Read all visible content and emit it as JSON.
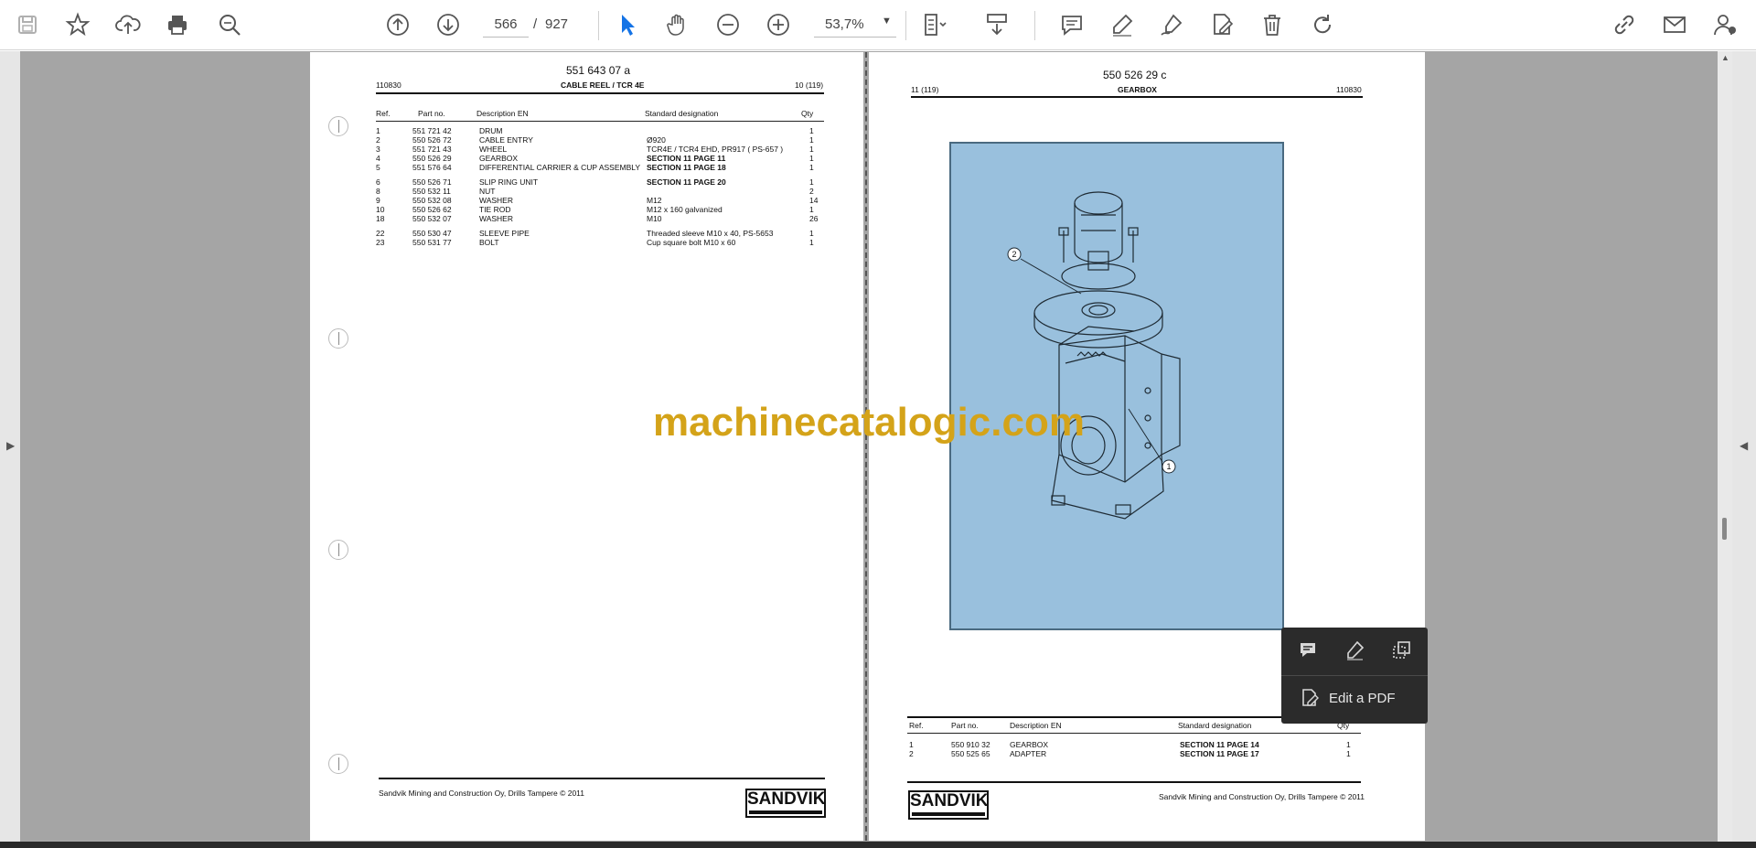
{
  "toolbar": {
    "icons": [
      "save-icon",
      "bookmark-star-icon",
      "upload-cloud-icon",
      "print-icon",
      "zoom-search-icon",
      "page-up-icon",
      "page-down-icon",
      "select-cursor-icon",
      "hand-tool-icon",
      "zoom-out-icon",
      "zoom-in-icon",
      "fit-page-icon",
      "scroll-mode-icon",
      "comment-icon",
      "highlight-icon",
      "sign-icon",
      "edit-pdf-icon",
      "delete-icon",
      "rotate-icon",
      "share-link-icon",
      "email-icon",
      "account-icon"
    ],
    "current_page": "566",
    "page_separator": "/",
    "total_pages": "927",
    "zoom": "53,7%"
  },
  "watermark": "machinecatalogic.com",
  "left_page": {
    "doc_number": "551 643 07 a",
    "date_code": "110830",
    "title": "CABLE REEL / TCR 4E",
    "page_ref": "10 (119)",
    "headers": {
      "ref": "Ref.",
      "part_no": "Part no.",
      "description": "Description EN",
      "standard": "Standard designation",
      "qty": "Qty"
    },
    "rows": [
      {
        "ref": "1",
        "part_no": "551 721 42",
        "description": "DRUM",
        "standard": "",
        "qty": "1"
      },
      {
        "ref": "2",
        "part_no": "550 526 72",
        "description": "CABLE ENTRY",
        "standard": "Ø920",
        "qty": "1"
      },
      {
        "ref": "3",
        "part_no": "551 721 43",
        "description": "WHEEL",
        "standard": "TCR4E / TCR4 EHD, PR917 ( PS-657 )",
        "qty": "1"
      },
      {
        "ref": "4",
        "part_no": "550 526 29",
        "description": "GEARBOX",
        "standard": "SECTION 11 PAGE 11",
        "qty": "1"
      },
      {
        "ref": "5",
        "part_no": "551 576 64",
        "description": "DIFFERENTIAL CARRIER & CUP ASSEMBLY",
        "standard": "SECTION 11 PAGE 18",
        "qty": "1"
      },
      {
        "ref": "6",
        "part_no": "550 526 71",
        "description": "SLIP RING UNIT",
        "standard": "SECTION 11 PAGE 20",
        "qty": "1"
      },
      {
        "ref": "8",
        "part_no": "550 532 11",
        "description": "NUT",
        "standard": "",
        "qty": "2"
      },
      {
        "ref": "9",
        "part_no": "550 532 08",
        "description": "WASHER",
        "standard": "M12",
        "qty": "14"
      },
      {
        "ref": "10",
        "part_no": "550 526 62",
        "description": "TIE ROD",
        "standard": "M12 x 160 galvanized",
        "qty": "1"
      },
      {
        "ref": "18",
        "part_no": "550 532 07",
        "description": "WASHER",
        "standard": "M10",
        "qty": "26"
      },
      {
        "ref": "22",
        "part_no": "550 530 47",
        "description": "SLEEVE PIPE",
        "standard": "Threaded sleeve M10 x 40, PS-5653",
        "qty": "1"
      },
      {
        "ref": "23",
        "part_no": "550 531 77",
        "description": "BOLT",
        "standard": "Cup square bolt M10 x 60",
        "qty": "1"
      }
    ],
    "footer": "Sandvik Mining and Construction Oy, Drills Tampere © 2011",
    "logo": "SANDVIK"
  },
  "right_page": {
    "doc_number": "550 526 29 c",
    "page_ref": "11 (119)",
    "title": "GEARBOX",
    "date_code": "110830",
    "callouts": [
      "2",
      "1"
    ],
    "headers": {
      "ref": "Ref.",
      "part_no": "Part no.",
      "description": "Description EN",
      "standard": "Standard designation",
      "qty": "Qty"
    },
    "rows": [
      {
        "ref": "1",
        "part_no": "550 910 32",
        "description": "GEARBOX",
        "standard": "SECTION 11 PAGE 14",
        "qty": "1"
      },
      {
        "ref": "2",
        "part_no": "550 525 65",
        "description": "ADAPTER",
        "standard": "SECTION 11 PAGE 17",
        "qty": "1"
      }
    ],
    "footer": "Sandvik Mining and Construction Oy, Drills Tampere © 2011",
    "logo": "SANDVIK"
  },
  "popup": {
    "icons": [
      "comment-icon",
      "highlight-pen-icon",
      "select-area-icon"
    ],
    "edit_label": "Edit a PDF"
  }
}
